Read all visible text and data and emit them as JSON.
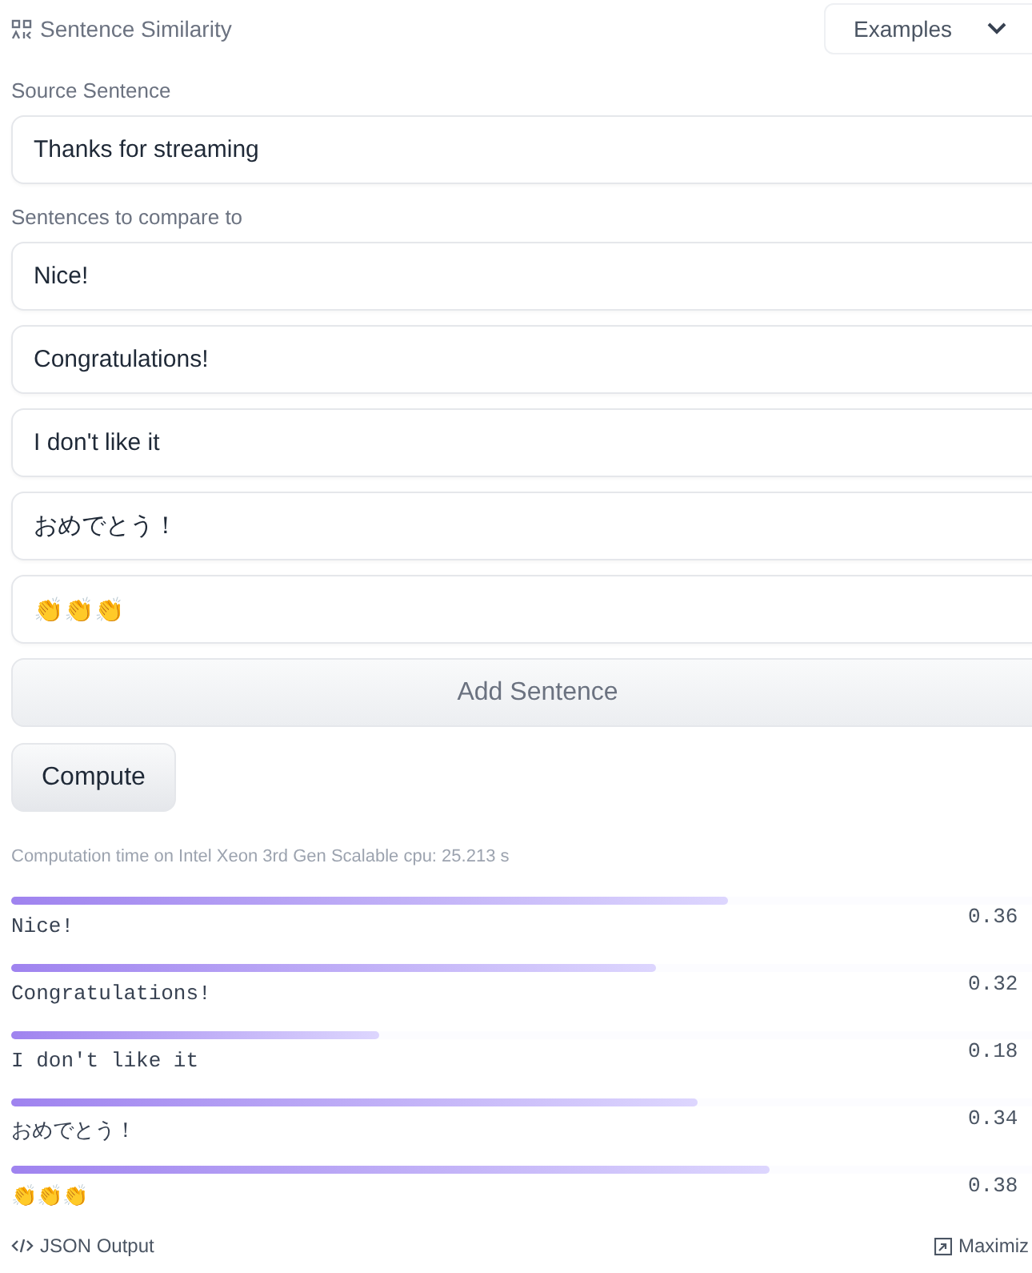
{
  "header": {
    "title": "Sentence Similarity",
    "examples_dropdown": "Examples"
  },
  "source": {
    "label": "Source Sentence",
    "value": "Thanks for streaming"
  },
  "compare": {
    "label": "Sentences to compare to",
    "sentences": [
      {
        "value": "Nice!"
      },
      {
        "value": "Congratulations!"
      },
      {
        "value": "I don't like it"
      },
      {
        "value": "おめでとう！"
      },
      {
        "value": "👏👏👏"
      }
    ]
  },
  "add_button": "Add Sentence",
  "compute_button": "Compute",
  "computation_time": "Computation time on Intel Xeon 3rd Gen Scalable cpu: 25.213 s",
  "results": [
    {
      "label": "Nice!",
      "score": "0.36",
      "level": 0.7
    },
    {
      "label": "Congratulations!",
      "score": "0.32",
      "level": 0.63
    },
    {
      "label": "I don't like it",
      "score": "0.18",
      "level": 0.36
    },
    {
      "label": "おめでとう！",
      "score": "0.34",
      "level": 0.67
    },
    {
      "label": "👏👏👏",
      "score": "0.38",
      "level": 0.74
    }
  ],
  "footer": {
    "json_output": "JSON Output",
    "maximize": "Maximiz"
  }
}
